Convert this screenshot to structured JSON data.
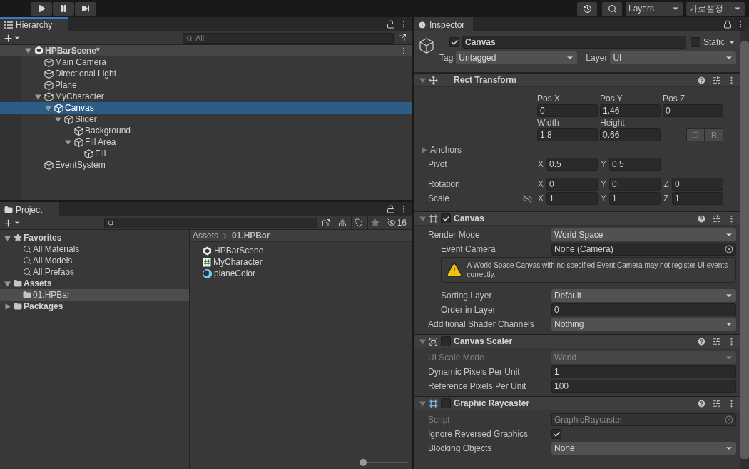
{
  "toolbar": {
    "layers": "Layers",
    "layout": "가로설정"
  },
  "hierarchy": {
    "title": "Hierarchy",
    "search": {
      "placeholder": "All"
    },
    "scene": {
      "name": "HPBarScene*",
      "expanded": true,
      "children": [
        {
          "name": "Main Camera",
          "selected": false
        },
        {
          "name": "Directional Light",
          "selected": false
        },
        {
          "name": "Plane",
          "selected": false
        },
        {
          "name": "MyCharacter",
          "selected": false,
          "expanded": true,
          "children": [
            {
              "name": "Canvas",
              "selected": true,
              "expanded": true,
              "children": [
                {
                  "name": "Slider",
                  "selected": false,
                  "expanded": true,
                  "children": [
                    {
                      "name": "Background",
                      "selected": false
                    },
                    {
                      "name": "Fill Area",
                      "selected": false,
                      "expanded": true,
                      "children": [
                        {
                          "name": "Fill",
                          "selected": false
                        }
                      ]
                    }
                  ]
                }
              ]
            }
          ]
        },
        {
          "name": "EventSystem",
          "selected": false
        }
      ]
    }
  },
  "project": {
    "title": "Project",
    "hidden_count": "16",
    "sidebar": [
      {
        "name": "Favorites",
        "kind": "favorites",
        "selected": false,
        "expanded": true,
        "children": [
          {
            "name": "All Materials",
            "kind": "search",
            "selected": false
          },
          {
            "name": "All Models",
            "kind": "search",
            "selected": false
          },
          {
            "name": "All Prefabs",
            "kind": "search",
            "selected": false
          }
        ]
      },
      {
        "name": "Assets",
        "kind": "folder",
        "selected": false,
        "expanded": true,
        "children": [
          {
            "name": "01.HPBar",
            "kind": "folder",
            "selected": true
          }
        ]
      },
      {
        "name": "Packages",
        "kind": "folder",
        "selected": false,
        "expanded": false
      }
    ],
    "breadcrumb": [
      "Assets",
      "01.HPBar"
    ],
    "assets": [
      {
        "name": "HPBarScene",
        "kind": "scene"
      },
      {
        "name": "MyCharacter",
        "kind": "script"
      },
      {
        "name": "planeColor",
        "kind": "material"
      }
    ],
    "zoom_slider": {
      "level": 0.05
    }
  },
  "inspector": {
    "title": "Inspector",
    "object": {
      "active": true,
      "name": "Canvas",
      "static": false,
      "static_label": "Static",
      "tag_label": "Tag",
      "tag": "Untagged",
      "layer_label": "Layer",
      "layer": "UI"
    },
    "components": [
      {
        "kind": "rect_transform",
        "title": "Rect Transform",
        "expanded": true,
        "position": [
          {
            "label": "Pos X",
            "value": "0"
          },
          {
            "label": "Pos Y",
            "value": "1.46"
          },
          {
            "label": "Pos Z",
            "value": "0"
          }
        ],
        "size": [
          {
            "label": "Width",
            "value": "1.8"
          },
          {
            "label": "Height",
            "value": "0.66"
          }
        ],
        "raw_button": "R",
        "anchors": {
          "label": "Anchors",
          "expanded": false
        },
        "rows": [
          {
            "label": "Pivot",
            "kind": "vector",
            "axes": [
              {
                "axis": "X",
                "value": "0.5"
              },
              {
                "axis": "Y",
                "value": "0.5"
              }
            ]
          },
          {
            "label": "Rotation",
            "kind": "vector",
            "axes": [
              {
                "axis": "X",
                "value": "0"
              },
              {
                "axis": "Y",
                "value": "0"
              },
              {
                "axis": "Z",
                "value": "0"
              }
            ]
          },
          {
            "label": "Scale",
            "kind": "scale",
            "axes": [
              {
                "axis": "X",
                "value": "1"
              },
              {
                "axis": "Y",
                "value": "1"
              },
              {
                "axis": "Z",
                "value": "1"
              }
            ]
          }
        ]
      },
      {
        "kind": "canvas",
        "title": "Canvas",
        "expanded": true,
        "enabled": true,
        "properties": [
          {
            "kind": "dropdown",
            "label": "Render Mode",
            "value": "World Space",
            "disabled": false,
            "children": [
              {
                "kind": "object",
                "label": "Event Camera",
                "value": "None (Camera)",
                "disabled": false
              },
              {
                "kind": "warning",
                "text": "A World Space Canvas with no specified Event Camera may not register UI events correctly."
              },
              {
                "kind": "dropdown",
                "label": "Sorting Layer",
                "value": "Default",
                "disabled": false
              },
              {
                "kind": "text",
                "label": "Order in Layer",
                "value": "0",
                "disabled": false
              }
            ]
          },
          {
            "kind": "dropdown",
            "label": "Additional Shader Channels",
            "value": "Nothing",
            "disabled": false
          }
        ]
      },
      {
        "kind": "scaler",
        "title": "Canvas Scaler",
        "expanded": true,
        "enabled": false,
        "properties": [
          {
            "kind": "dropdown",
            "label": "UI Scale Mode",
            "value": "World",
            "disabled": true
          },
          {
            "kind": "text",
            "label": "Dynamic Pixels Per Unit",
            "value": "1",
            "disabled": false
          },
          {
            "kind": "text",
            "label": "Reference Pixels Per Unit",
            "value": "100",
            "disabled": false
          }
        ]
      },
      {
        "kind": "raycaster",
        "title": "Graphic Raycaster",
        "expanded": true,
        "enabled": false,
        "properties": [
          {
            "kind": "object",
            "label": "Script",
            "value": "GraphicRaycaster",
            "disabled": true
          },
          {
            "kind": "checkbox",
            "label": "Ignore Reversed Graphics",
            "checked": true,
            "disabled": false
          },
          {
            "kind": "dropdown",
            "label": "Blocking Objects",
            "value": "None",
            "disabled": false
          }
        ]
      }
    ]
  }
}
